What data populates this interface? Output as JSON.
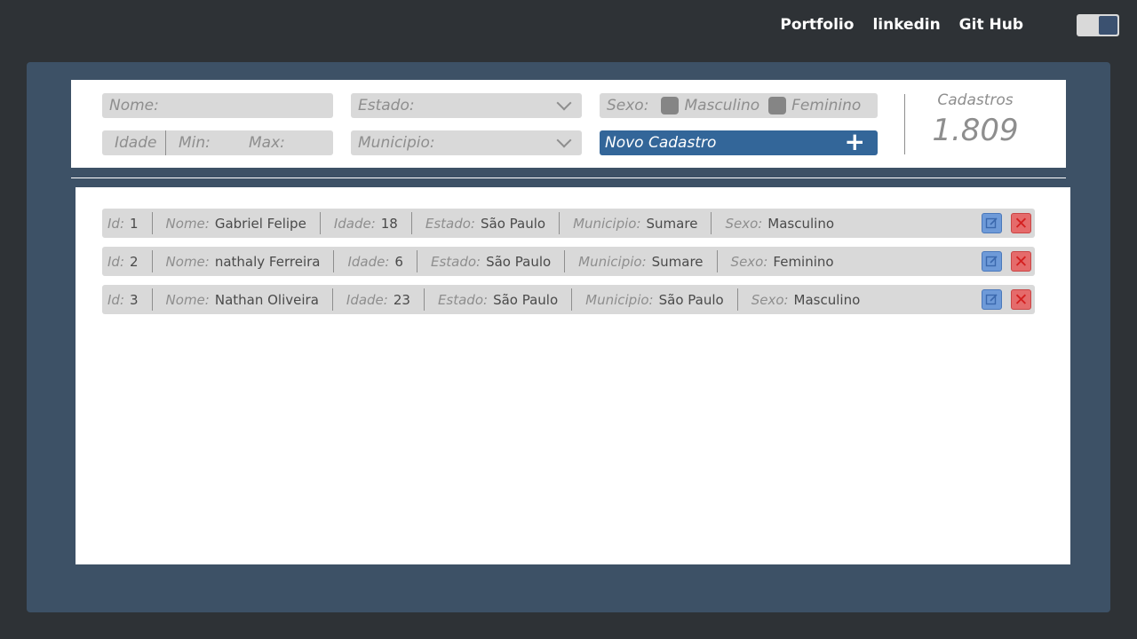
{
  "nav": {
    "links": [
      "Portfolio",
      "linkedin",
      "Git Hub"
    ]
  },
  "filters": {
    "nome_placeholder": "Nome:",
    "estado_placeholder": "Estado:",
    "sexo_label": "Sexo:",
    "sexo_options": [
      "Masculino",
      "Feminino"
    ],
    "idade_label": "Idade",
    "min_label": "Min:",
    "max_label": "Max:",
    "municipio_placeholder": "Municipio:",
    "novo_cadastro_label": "Novo Cadastro",
    "plus_glyph": "+"
  },
  "counter": {
    "label": "Cadastros",
    "value": "1.809"
  },
  "field_labels": {
    "id": "Id:",
    "nome": "Nome:",
    "idade": "Idade:",
    "estado": "Estado:",
    "municipio": "Municipio:",
    "sexo": "Sexo:"
  },
  "records": [
    {
      "id": "1",
      "nome": "Gabriel Felipe",
      "idade": "18",
      "estado": "São Paulo",
      "municipio": "Sumare",
      "sexo": "Masculino"
    },
    {
      "id": "2",
      "nome": "nathaly Ferreira",
      "idade": "6",
      "estado": "São Paulo",
      "municipio": "Sumare",
      "sexo": "Feminino"
    },
    {
      "id": "3",
      "nome": "Nathan Oliveira",
      "idade": "23",
      "estado": "São Paulo",
      "municipio": "São Paulo",
      "sexo": "Masculino"
    }
  ],
  "icons": {
    "edit": "edit-icon",
    "delete": "delete-icon",
    "delete_glyph": "✕"
  },
  "colors": {
    "background": "#2e3236",
    "panel": "#3d5166",
    "accent": "#336699",
    "delete": "#e56b6b",
    "edit": "#6e9ad8"
  }
}
